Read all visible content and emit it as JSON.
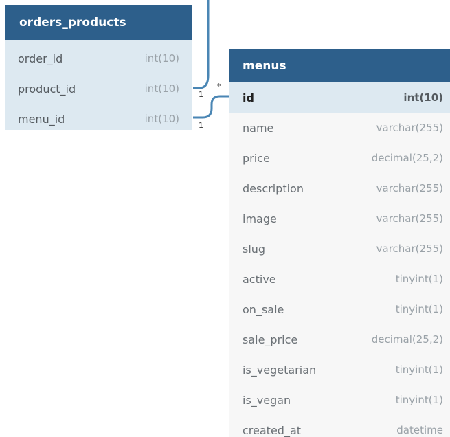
{
  "orders_products": {
    "title": "orders_products",
    "columns": [
      {
        "name": "order_id",
        "type": "int(10)"
      },
      {
        "name": "product_id",
        "type": "int(10)"
      },
      {
        "name": "menu_id",
        "type": "int(10)"
      }
    ]
  },
  "menus": {
    "title": "menus",
    "columns": [
      {
        "name": "id",
        "type": "int(10)"
      },
      {
        "name": "name",
        "type": "varchar(255)"
      },
      {
        "name": "price",
        "type": "decimal(25,2)"
      },
      {
        "name": "description",
        "type": "varchar(255)"
      },
      {
        "name": "image",
        "type": "varchar(255)"
      },
      {
        "name": "slug",
        "type": "varchar(255)"
      },
      {
        "name": "active",
        "type": "tinyint(1)"
      },
      {
        "name": "on_sale",
        "type": "tinyint(1)"
      },
      {
        "name": "sale_price",
        "type": "decimal(25,2)"
      },
      {
        "name": "is_vegetarian",
        "type": "tinyint(1)"
      },
      {
        "name": "is_vegan",
        "type": "tinyint(1)"
      },
      {
        "name": "created_at",
        "type": "datetime"
      }
    ]
  },
  "relations": {
    "product_label_one": "1",
    "product_label_many": "*",
    "menu_label_one": "1"
  },
  "colors": {
    "header": "#2d5f8b",
    "row_highlight": "#dde9f1",
    "connector": "#4a86b4"
  }
}
